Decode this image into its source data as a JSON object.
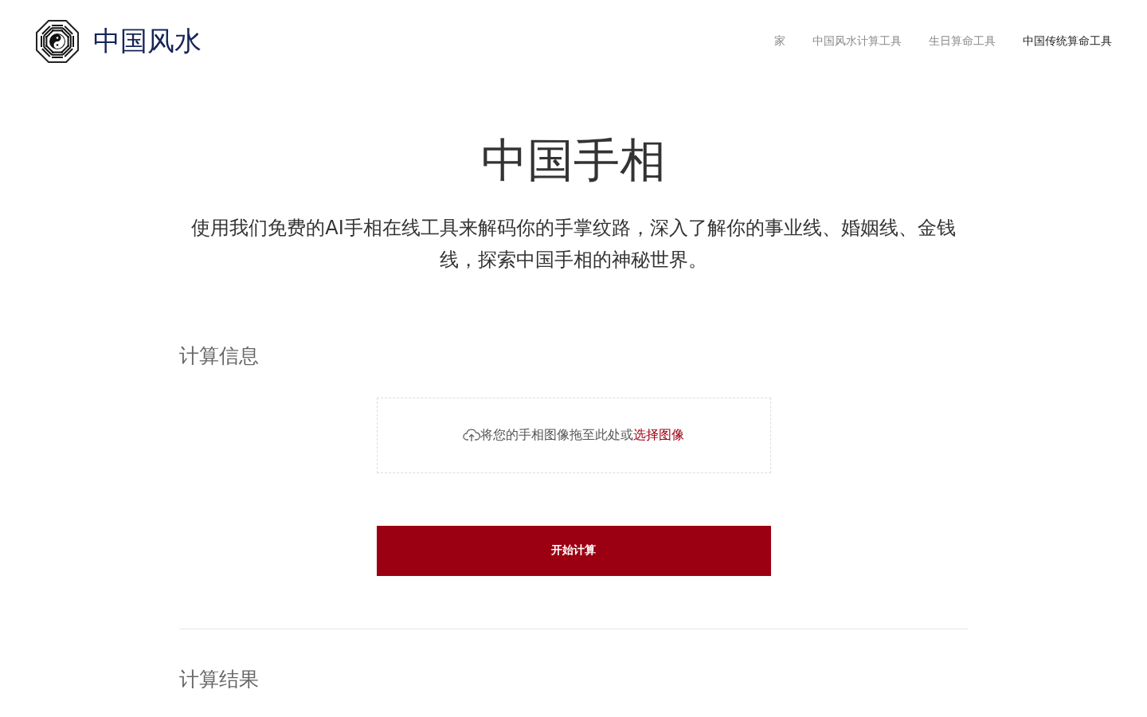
{
  "header": {
    "site_name": "中国风水",
    "nav": [
      {
        "label": "家",
        "selected": false
      },
      {
        "label": "中国风水计算工具",
        "selected": false
      },
      {
        "label": "生日算命工具",
        "selected": false
      },
      {
        "label": "中国传统算命工具",
        "selected": true
      }
    ]
  },
  "hero": {
    "title": "中国手相",
    "subtitle": "使用我们免费的AI手相在线工具来解码你的手掌纹路，深入了解你的事业线、婚姻线、金钱线，探索中国手相的神秘世界。"
  },
  "input_section": {
    "heading": "计算信息",
    "upload": {
      "prompt": "将您的手相图像拖至此处或",
      "link": "选择图像"
    },
    "button": "开始计算"
  },
  "result_section": {
    "heading": "计算结果"
  }
}
